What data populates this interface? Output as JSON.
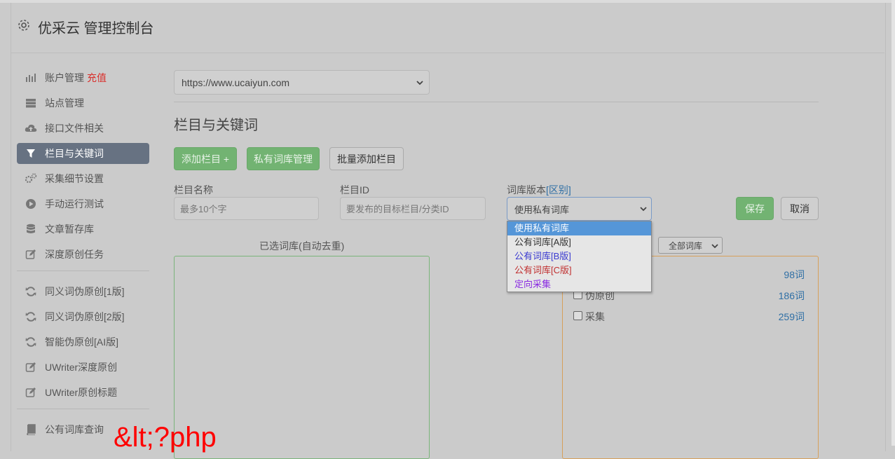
{
  "header": {
    "title": "优采云 管理控制台"
  },
  "sidebar": {
    "group1": [
      {
        "label": "账户管理",
        "extra": "充值",
        "icon": "bar-chart-icon"
      },
      {
        "label": "站点管理",
        "icon": "server-icon"
      },
      {
        "label": "接口文件相关",
        "icon": "cloud-upload-icon"
      },
      {
        "label": "栏目与关键词",
        "icon": "filter-icon",
        "active": true
      },
      {
        "label": "采集细节设置",
        "icon": "cogs-icon"
      },
      {
        "label": "手动运行测试",
        "icon": "play-circle-icon"
      },
      {
        "label": "文章暂存库",
        "icon": "database-icon"
      },
      {
        "label": "深度原创任务",
        "icon": "edit-icon"
      }
    ],
    "group2": [
      {
        "label": "同义词伪原创[1版]",
        "icon": "refresh-icon"
      },
      {
        "label": "同义词伪原创[2版]",
        "icon": "refresh-icon"
      },
      {
        "label": "智能伪原创[AI版]",
        "icon": "refresh-icon"
      },
      {
        "label": "UWriter深度原创",
        "icon": "edit-icon"
      },
      {
        "label": "UWriter原创标题",
        "icon": "edit-icon"
      }
    ],
    "group3": [
      {
        "label": "公有词库查询",
        "icon": "book-icon"
      }
    ]
  },
  "main": {
    "site_select": "https://www.ucaiyun.com",
    "section_title": "栏目与关键词",
    "buttons": {
      "add_column": "添加栏目 +",
      "private_lib": "私有词库管理",
      "batch_add": "批量添加栏目",
      "save": "保存",
      "cancel": "取消"
    },
    "form": {
      "name_label": "栏目名称",
      "name_placeholder": "最多10个字",
      "id_label": "栏目ID",
      "id_placeholder": "要发布的目标栏目/分类ID",
      "version_label": "词库版本",
      "version_link": "[区别]",
      "version_value": "使用私有词库"
    },
    "dropdown_options": [
      {
        "label": "使用私有词库",
        "color": "#ffffff",
        "selected": true
      },
      {
        "label": "公有词库[A版]",
        "color": "#333333"
      },
      {
        "label": "公有词库[B版]",
        "color": "#3a3ad0"
      },
      {
        "label": "公有词库[C版]",
        "color": "#c03030"
      },
      {
        "label": "定向采集",
        "color": "#8a2be2"
      }
    ],
    "selected_panel_title": "已选词库(自动去重)",
    "library_filter": "全部词库",
    "libraries": [
      {
        "name": "",
        "count": "98词"
      },
      {
        "name": "伪原创",
        "count": "186词"
      },
      {
        "name": "采集",
        "count": "259词"
      }
    ]
  },
  "overlay_text": "&lt;?php"
}
